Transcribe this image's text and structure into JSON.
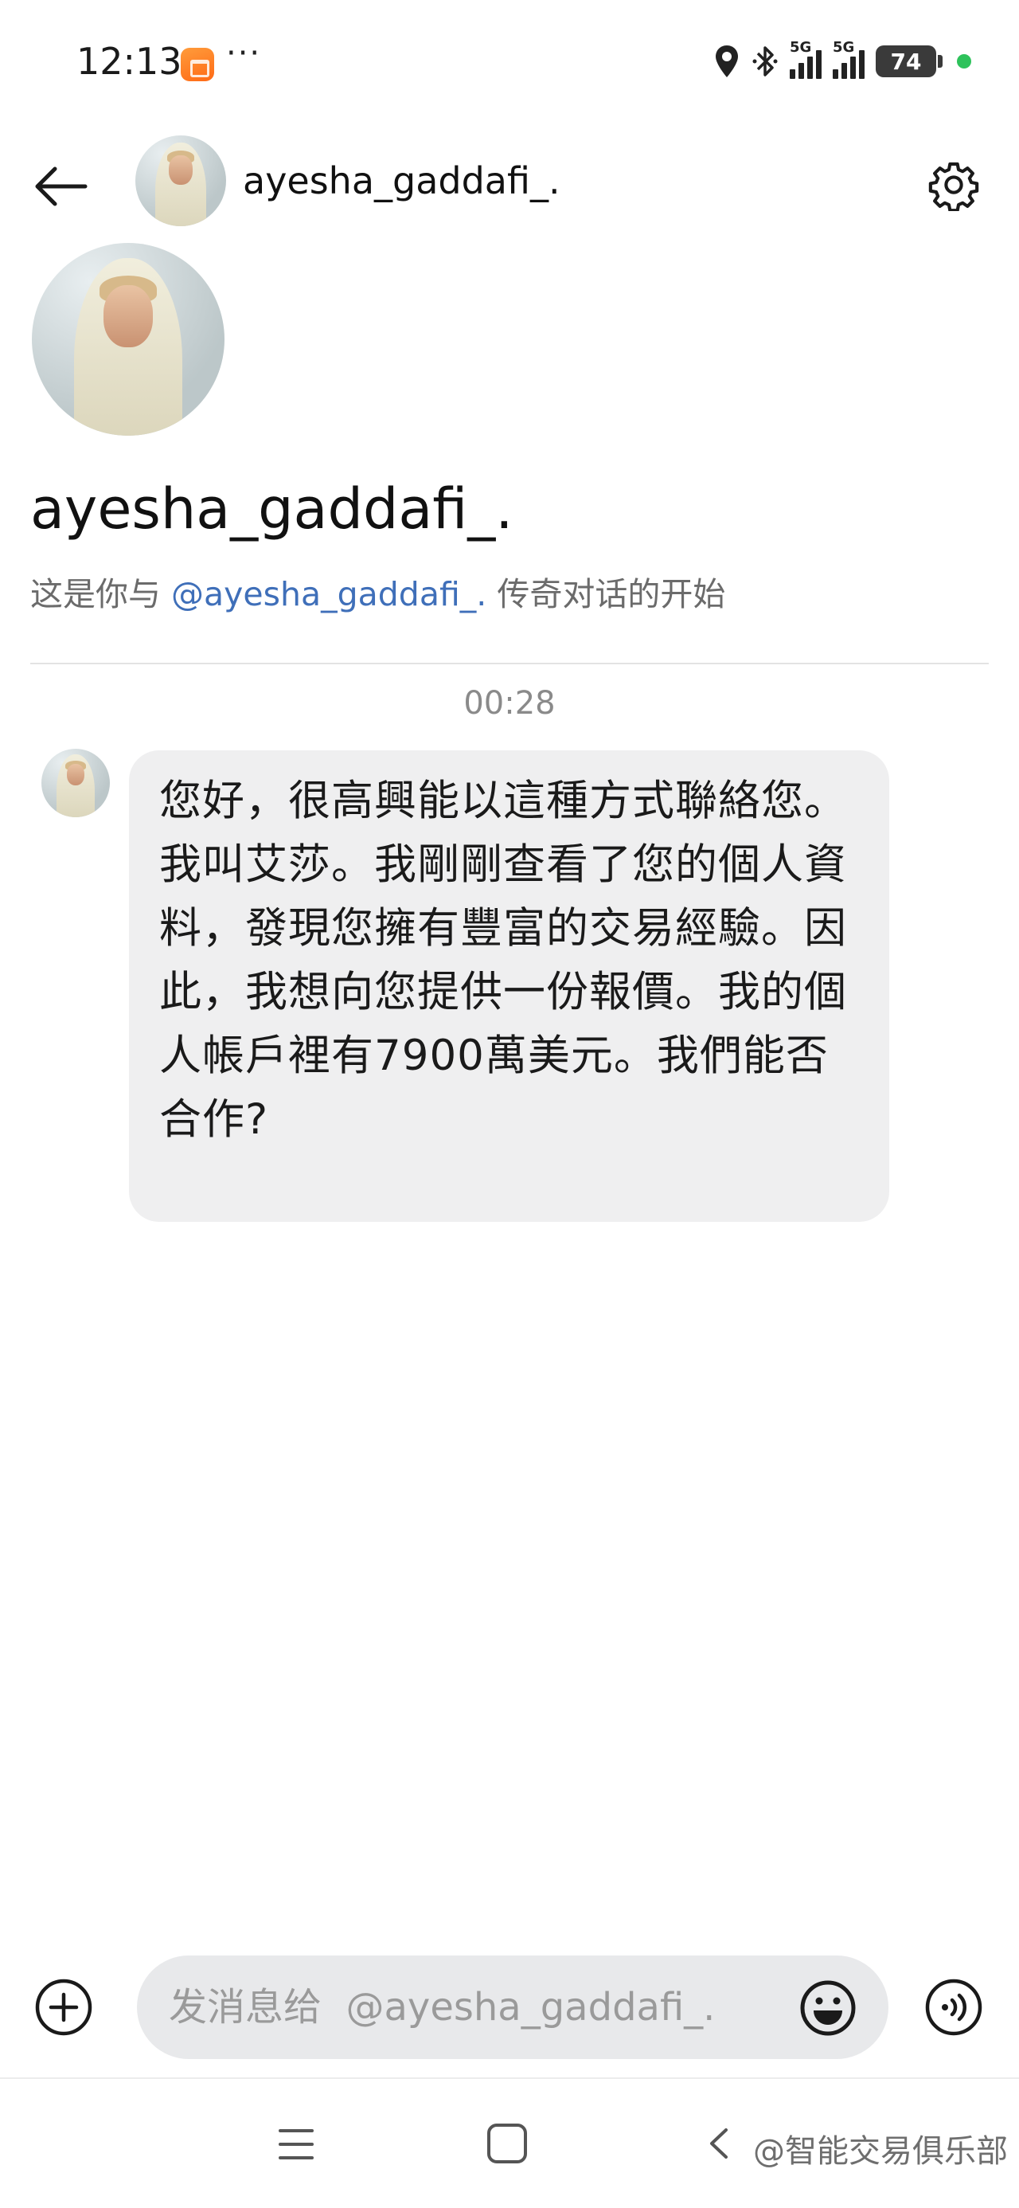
{
  "status_bar": {
    "time": "12:13",
    "more": "···",
    "network_1": "5G",
    "network_2": "5G",
    "battery": "74",
    "icons": [
      "location-icon",
      "bluetooth-icon",
      "signal-icon",
      "battery-icon"
    ]
  },
  "header": {
    "username": "ayesha_gaddafi_."
  },
  "profile": {
    "name": "ayesha_gaddafi_.",
    "intro_prefix": "这是你与 ",
    "intro_mention": "@ayesha_gaddafi_.",
    "intro_suffix": " 传奇对话的开始"
  },
  "chat": {
    "timestamp": "00:28",
    "message": "您好，很高興能以這種方式聯絡您。我叫艾莎。我剛剛查看了您的個人資料，發現您擁有豐富的交易經驗。因此，我想向您提供一份報價。我的個人帳戶裡有7900萬美元。我們能否合作?"
  },
  "composer": {
    "placeholder": "发消息给  @ayesha_gaddafi_."
  },
  "watermark": "@智能交易俱乐部",
  "colors": {
    "mention": "#3f6fb9",
    "bubble": "#efeff0",
    "input": "#e8e9eb"
  }
}
